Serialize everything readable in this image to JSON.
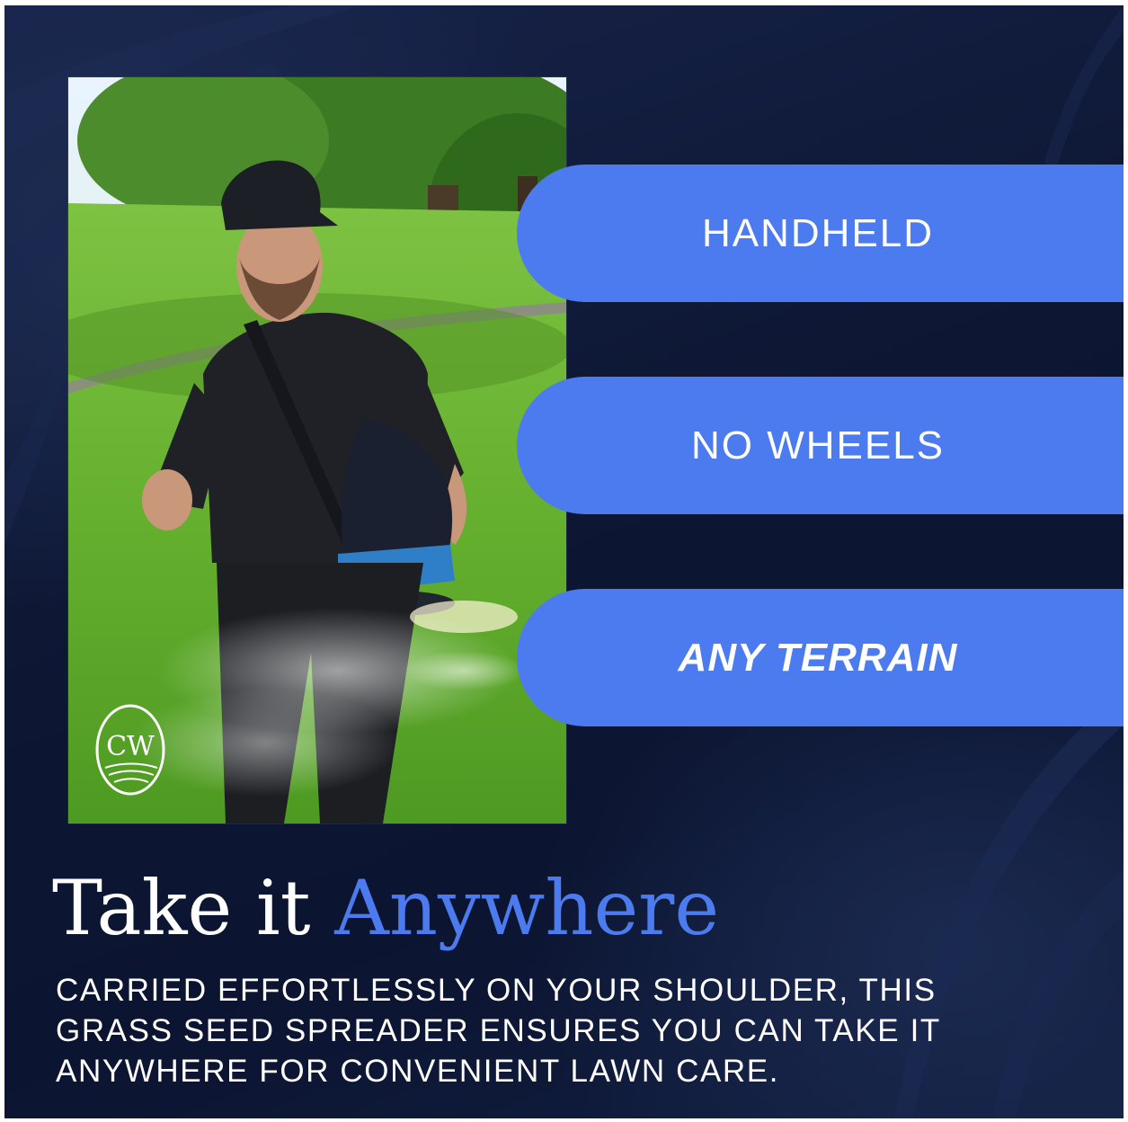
{
  "features": [
    {
      "label": "HANDHELD"
    },
    {
      "label": "NO WHEELS"
    },
    {
      "label": "ANY TERRAIN"
    }
  ],
  "headline": {
    "lead": "Take it",
    "accent": "Anywhere"
  },
  "description": {
    "lines": [
      "CARRIED EFFORTLESSLY ON YOUR SHOULDER, THIS",
      "GRASS SEED SPREADER ENSURES YOU CAN TAKE IT",
      "ANYWHERE FOR CONVENIENT LAWN CARE."
    ]
  },
  "logo": {
    "monogram": "CW"
  },
  "colors": {
    "background": "#0d1733",
    "accent": "#4b7bef",
    "text": "#ffffff"
  }
}
